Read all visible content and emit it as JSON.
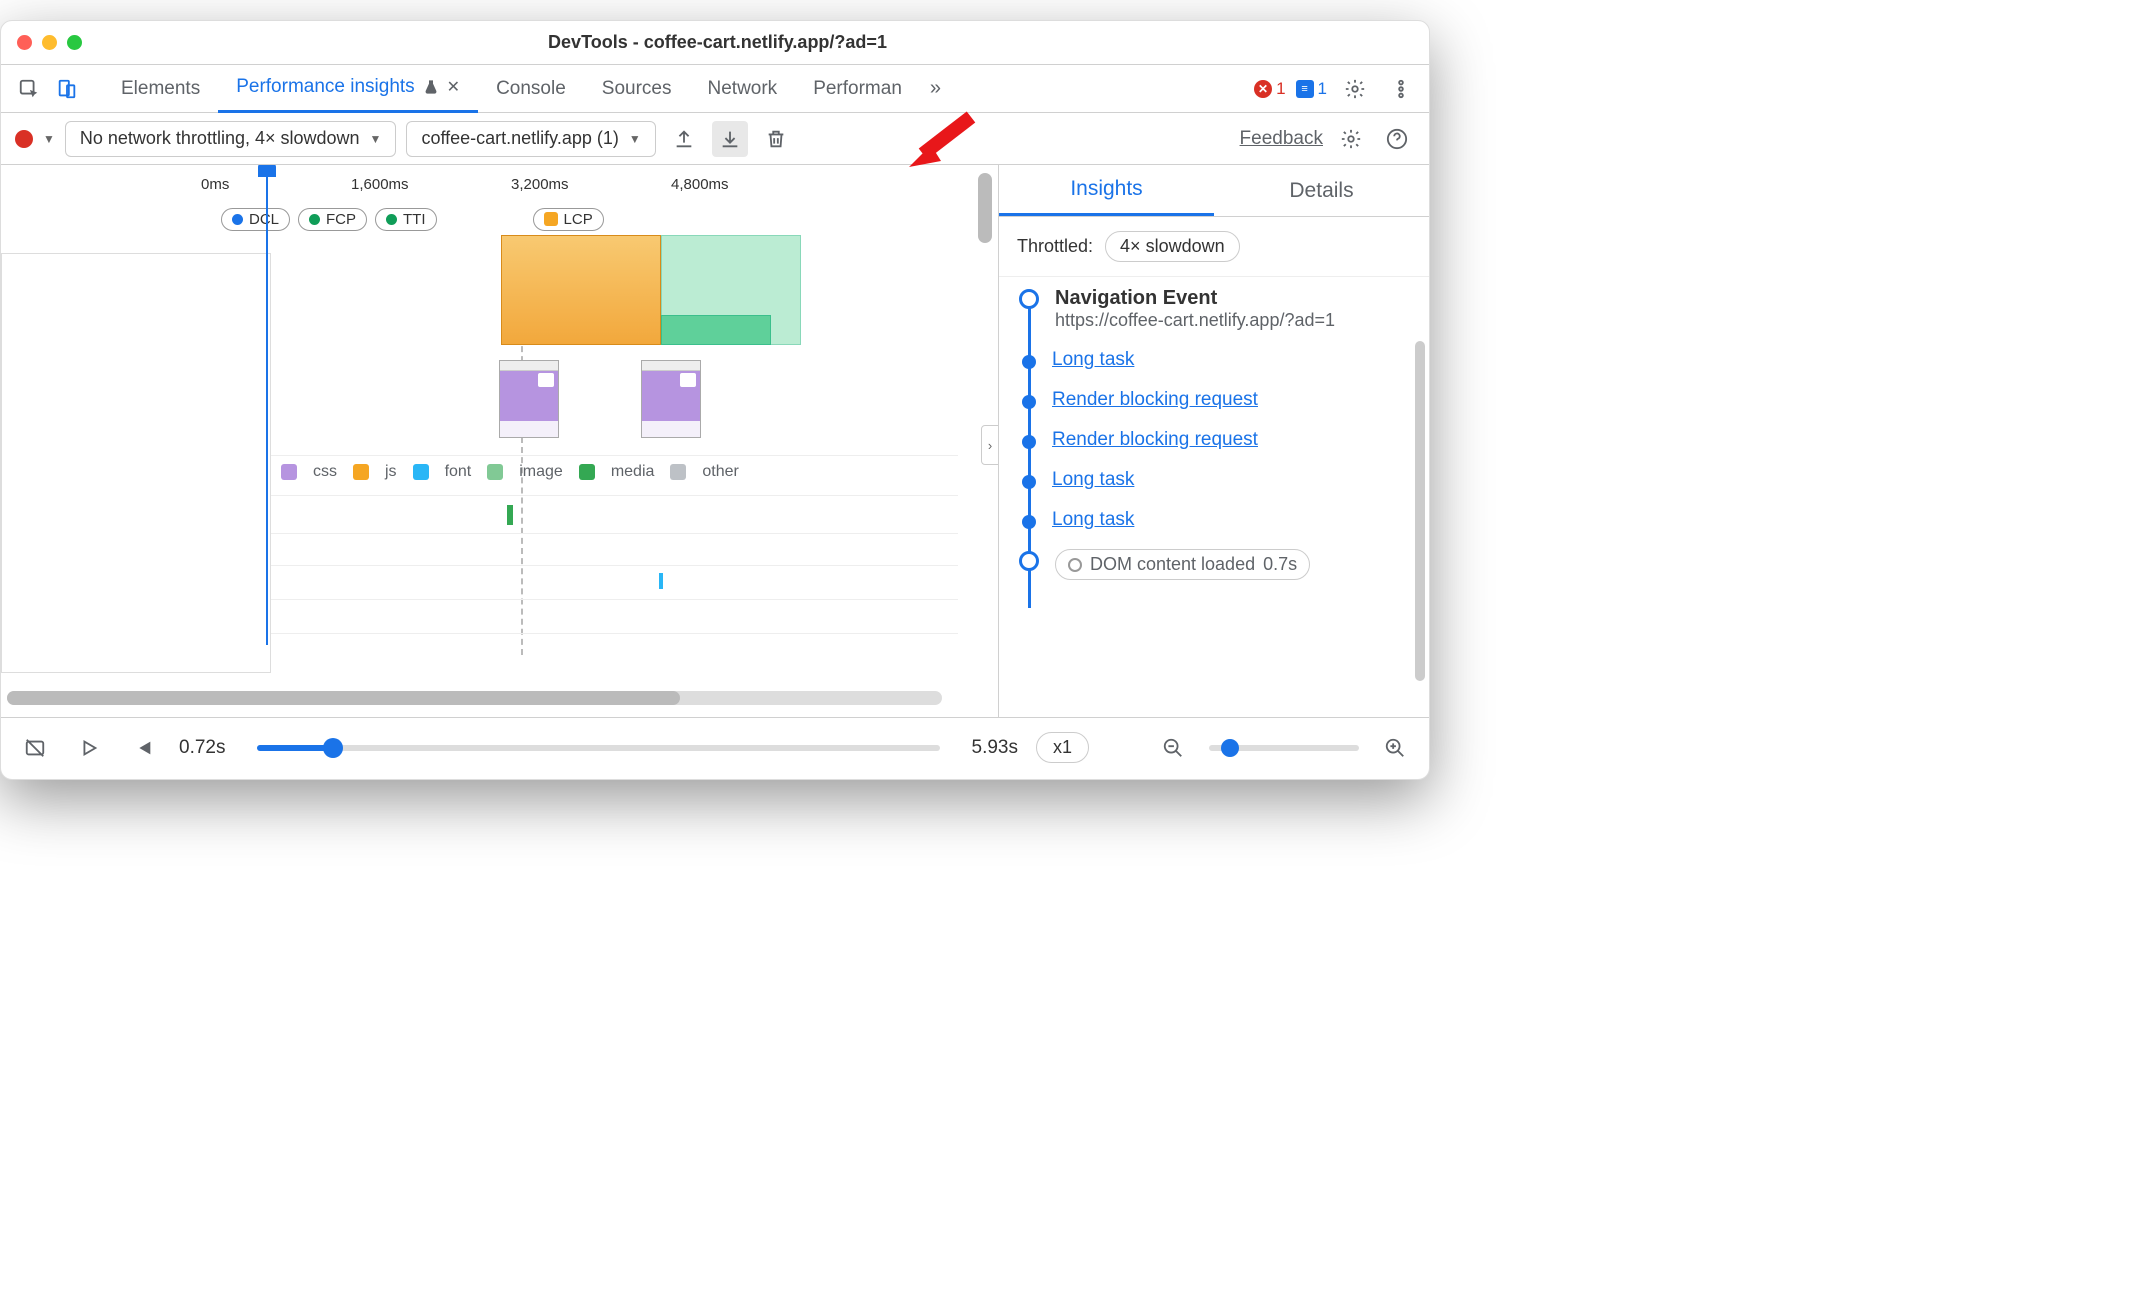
{
  "window": {
    "title": "DevTools - coffee-cart.netlify.app/?ad=1"
  },
  "tabs": {
    "elements": "Elements",
    "perf_insights": "Performance insights",
    "console": "Console",
    "sources": "Sources",
    "network": "Network",
    "performance": "Performan",
    "overflow": "»"
  },
  "badges": {
    "errors": "1",
    "messages": "1"
  },
  "toolbar": {
    "throttling_label": "No network throttling, 4× slowdown",
    "recording_label": "coffee-cart.netlify.app (1)",
    "feedback": "Feedback"
  },
  "timeline": {
    "ticks": [
      "0ms",
      "1,600ms",
      "3,200ms",
      "4,800ms"
    ],
    "markers": {
      "dcl": "DCL",
      "fcp": "FCP",
      "tti": "TTI",
      "lcp": "LCP"
    },
    "legend": {
      "css": "css",
      "js": "js",
      "font": "font",
      "image": "image",
      "media": "media",
      "other": "other"
    }
  },
  "sidepanel": {
    "tabs": {
      "insights": "Insights",
      "details": "Details"
    },
    "throttled_label": "Throttled:",
    "throttled_value": "4× slowdown",
    "nav_event_title": "Navigation Event",
    "nav_event_url": "https://coffee-cart.netlify.app/?ad=1",
    "items": {
      "long_task_1": "Long task",
      "render_block_1": "Render blocking request",
      "render_block_2": "Render blocking request",
      "long_task_2": "Long task",
      "long_task_3": "Long task",
      "dcl": "DOM content loaded",
      "dcl_time": "0.7s"
    }
  },
  "playbar": {
    "start_time": "0.72s",
    "end_time": "5.93s",
    "speed": "x1"
  },
  "colors": {
    "css": "#b694e0",
    "js": "#f5a623",
    "font": "#29b6f6",
    "image": "#81c995",
    "media": "#34a853",
    "other": "#bdc1c6",
    "accent": "#1a73e8"
  }
}
